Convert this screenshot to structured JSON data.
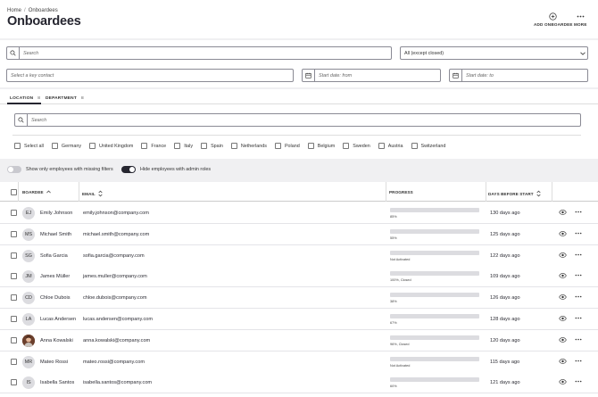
{
  "breadcrumb": {
    "home": "Home",
    "separator": "/",
    "current": "Onboardees"
  },
  "page_title": "Onboardees",
  "header_actions": {
    "add": "ADD ONBOARDEE",
    "more": "MORE"
  },
  "filters": {
    "search_placeholder": "Search",
    "status_value": "All (except closed)",
    "key_contact_placeholder": "Select a key contact",
    "start_from_placeholder": "Start date: from",
    "start_to_placeholder": "Start date: to"
  },
  "tabs": [
    {
      "label": "LOCATION",
      "count": "8"
    },
    {
      "label": "DEPARTMENT",
      "count": "8"
    }
  ],
  "location_search_placeholder": "Search",
  "select_all_label": "Select all",
  "locations": [
    "Germany",
    "United Kingdom",
    "France",
    "Italy",
    "Spain",
    "Netherlands",
    "Poland",
    "Belgium",
    "Sweden",
    "Austria",
    "Switzerland"
  ],
  "toggles": {
    "missing_filters": {
      "label": "Show only employees with missing filters",
      "on": false
    },
    "hide_admin": {
      "label": "Hide employees with admin roles",
      "on": true
    }
  },
  "columns": {
    "boardee": "BOARDEE",
    "email": "EMAIL",
    "progress": "PROGRESS",
    "days": "DAYS BEFORE START"
  },
  "colors": {
    "accent": "#262630",
    "track": "#dcdce0"
  },
  "rows": [
    {
      "initials": "EJ",
      "name": "Emily Johnson",
      "email": "emily.johnson@company.com",
      "progress": 0.85,
      "progress_label": "85%",
      "days": "130 days ago",
      "photo": false
    },
    {
      "initials": "MS",
      "name": "Michael Smith",
      "email": "michael.smith@company.com",
      "progress": 0.55,
      "progress_label": "55%",
      "days": "125 days ago",
      "photo": false
    },
    {
      "initials": "SG",
      "name": "Sofia Garcia",
      "email": "sofia.garcia@company.com",
      "progress": 0,
      "progress_label": "Not Activated",
      "days": "122 days ago",
      "photo": false
    },
    {
      "initials": "JM",
      "name": "James Müller",
      "email": "james.muller@company.com",
      "progress": 1.0,
      "progress_label": "100%, Closed",
      "days": "109 days ago",
      "photo": false
    },
    {
      "initials": "CD",
      "name": "Chloe Dubois",
      "email": "chloe.dubois@company.com",
      "progress": 0.38,
      "progress_label": "38%",
      "days": "126 days ago",
      "photo": false
    },
    {
      "initials": "LA",
      "name": "Lucas Andersen",
      "email": "lucas.andersen@company.com",
      "progress": 0.67,
      "progress_label": "67%",
      "days": "128 days ago",
      "photo": false
    },
    {
      "initials": "",
      "name": "Anna Kowalski",
      "email": "anna.kowalski@company.com",
      "progress": 0.96,
      "progress_label": "96%, Closed",
      "days": "120 days ago",
      "photo": true
    },
    {
      "initials": "MR",
      "name": "Mateo Rossi",
      "email": "mateo.rossi@company.com",
      "progress": 0,
      "progress_label": "Not Activated",
      "days": "115 days ago",
      "photo": false
    },
    {
      "initials": "IS",
      "name": "Isabella Santos",
      "email": "isabella.santos@company.com",
      "progress": 0.6,
      "progress_label": "60%",
      "days": "121 days ago",
      "photo": false
    }
  ]
}
